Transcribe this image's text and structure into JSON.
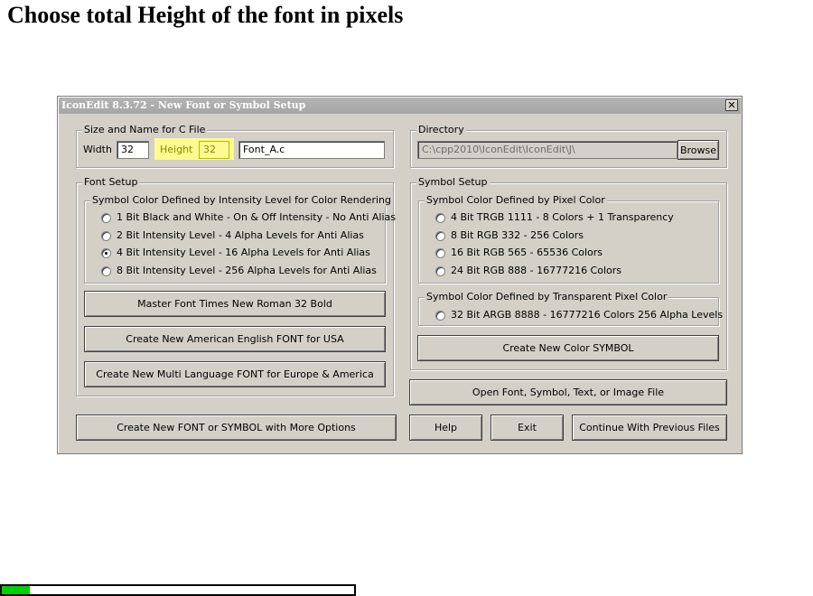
{
  "page": {
    "heading": "Choose total Height of the font in pixels"
  },
  "window": {
    "title": "IconEdit 8.3.72 - New Font or Symbol Setup",
    "close_glyph": "✕"
  },
  "size_group": {
    "legend": "Size and Name for C File",
    "width_label": "Width",
    "width_value": "32",
    "height_label": "Height",
    "height_value": "32",
    "file_name": "Font_A.c"
  },
  "directory_group": {
    "legend": "Directory",
    "path": "C:\\cpp2010\\IconEdit\\IconEdit\\J\\",
    "browse_label": "Browse"
  },
  "font_setup": {
    "legend": "Font Setup",
    "intensity_legend": "Symbol Color Defined by Intensity Level for Color Rendering",
    "options": [
      {
        "label": "1 Bit Black and White - On & Off Intensity - No Anti Alias",
        "selected": false
      },
      {
        "label": "2 Bit Intensity Level - 4 Alpha Levels for Anti Alias",
        "selected": false
      },
      {
        "label": "4 Bit Intensity Level - 16 Alpha Levels for Anti Alias",
        "selected": true
      },
      {
        "label": "8 Bit Intensity Level - 256 Alpha Levels for Anti Alias",
        "selected": false
      }
    ],
    "master_font_label": "Master Font  Times New Roman 32 Bold",
    "create_english_label": "Create New American English FONT for USA",
    "create_multi_label": "Create New Multi Language FONT for Europe & America"
  },
  "symbol_setup": {
    "legend": "Symbol Setup",
    "pixel_legend": "Symbol Color Defined by Pixel Color",
    "pixel_options": [
      {
        "label": "4 Bit TRGB 1111 - 8 Colors + 1 Transparency",
        "selected": false
      },
      {
        "label": "8 Bit RGB 332 - 256 Colors",
        "selected": false
      },
      {
        "label": "16 Bit RGB 565 - 65536 Colors",
        "selected": false
      },
      {
        "label": "24 Bit RGB 888 - 16777216 Colors",
        "selected": false
      }
    ],
    "transparent_legend": "Symbol Color Defined by Transparent Pixel Color",
    "transparent_options": [
      {
        "label": "32 Bit ARGB 8888 - 16777216 Colors 256 Alpha Levels",
        "selected": false
      }
    ],
    "create_symbol_label": "Create New Color SYMBOL"
  },
  "buttons": {
    "open_file": "Open Font, Symbol, Text, or Image File",
    "create_more": "Create New FONT or SYMBOL with More Options",
    "help": "Help",
    "exit": "Exit",
    "continue": "Continue With Previous Files"
  },
  "progress": {
    "fraction": 0.08,
    "fill_color": "#00d000"
  },
  "colors": {
    "highlight": "#fdfb8f",
    "dialog_bg": "#d4d0c8",
    "titlebar": "#a6a6a6"
  }
}
